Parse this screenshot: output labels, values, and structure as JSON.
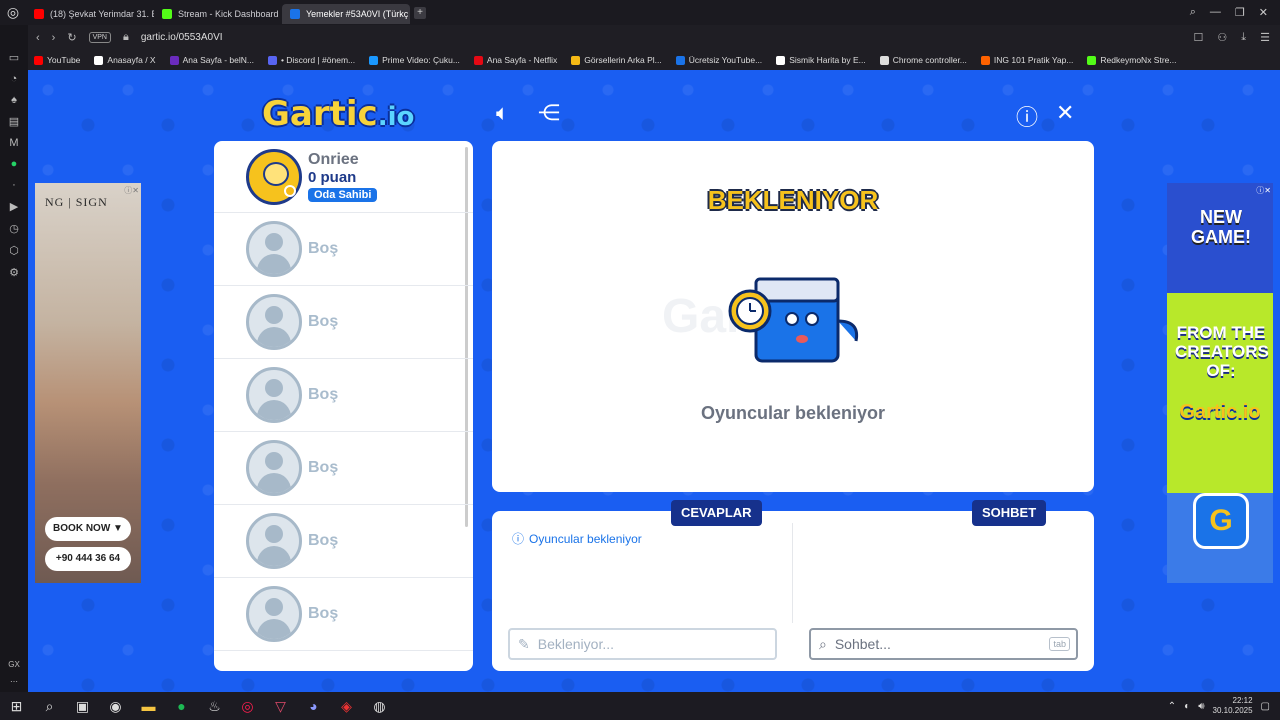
{
  "browser": {
    "tabs": [
      {
        "label": "(18) Şevkat Yerimdar 31. B",
        "color": "#ff0000",
        "icon": "youtube-icon"
      },
      {
        "label": "Stream - Kick Dashboard",
        "color": "#53fc18",
        "icon": "kick-icon"
      },
      {
        "label": "Yemekler #53A0VI (Türkç",
        "color": "#1a73e8",
        "icon": "gartic-icon"
      }
    ],
    "url": "gartic.io/0553A0VI",
    "vpn_label": "VPN",
    "bookmarks": [
      {
        "label": "YouTube",
        "color": "#ff0000"
      },
      {
        "label": "Anasayfa / X",
        "color": "#ffffff"
      },
      {
        "label": "Ana Sayfa - belN...",
        "color": "#6a2bbd"
      },
      {
        "label": "• Discord | #önem...",
        "color": "#5865f2"
      },
      {
        "label": "Prime Video: Çuku...",
        "color": "#1a98ff"
      },
      {
        "label": "Ana Sayfa - Netflix",
        "color": "#e50914"
      },
      {
        "label": "Görsellerin Arka Pl...",
        "color": "#f5b915"
      },
      {
        "label": "Ücretsiz YouTube...",
        "color": "#1a73e8"
      },
      {
        "label": "Sismik Harita by E...",
        "color": "#ffffff"
      },
      {
        "label": "Chrome controller...",
        "color": "#dddddd"
      },
      {
        "label": "ING 101 Pratik Yap...",
        "color": "#ff6200"
      },
      {
        "label": "RedkeymoNx Stre...",
        "color": "#53fc18"
      }
    ]
  },
  "sidebar": {
    "bottom_label": "GX"
  },
  "game": {
    "logo": "Gartic",
    "logo_suffix": ".io",
    "players": [
      {
        "name": "Onriee",
        "points": "0 puan",
        "badge": "Oda Sahibi",
        "owner": true
      },
      {
        "name": "Boş"
      },
      {
        "name": "Boş"
      },
      {
        "name": "Boş"
      },
      {
        "name": "Boş"
      },
      {
        "name": "Boş"
      },
      {
        "name": "Boş"
      }
    ],
    "status_title": "BEKLENIYOR",
    "status_text": "Oyuncular bekleniyor",
    "answers_tab": "CEVAPLAR",
    "chat_tab": "SOHBET",
    "answers_info": "Oyuncular bekleniyor",
    "answer_placeholder": "Bekleniyor...",
    "chat_placeholder": "Sohbet...",
    "tab_key": "tab"
  },
  "ads": {
    "left": {
      "brand": "NG | SIGN",
      "cta": "BOOK NOW ▼",
      "phone": "+90 444 36 64"
    },
    "right": {
      "title": "NEW GAME!",
      "subtitle": "FROM THE CREATORS OF:",
      "brand": "Gartic.io",
      "icon_letter": "G"
    }
  },
  "taskbar": {
    "time": "22:12",
    "date": "30.10.2025"
  }
}
